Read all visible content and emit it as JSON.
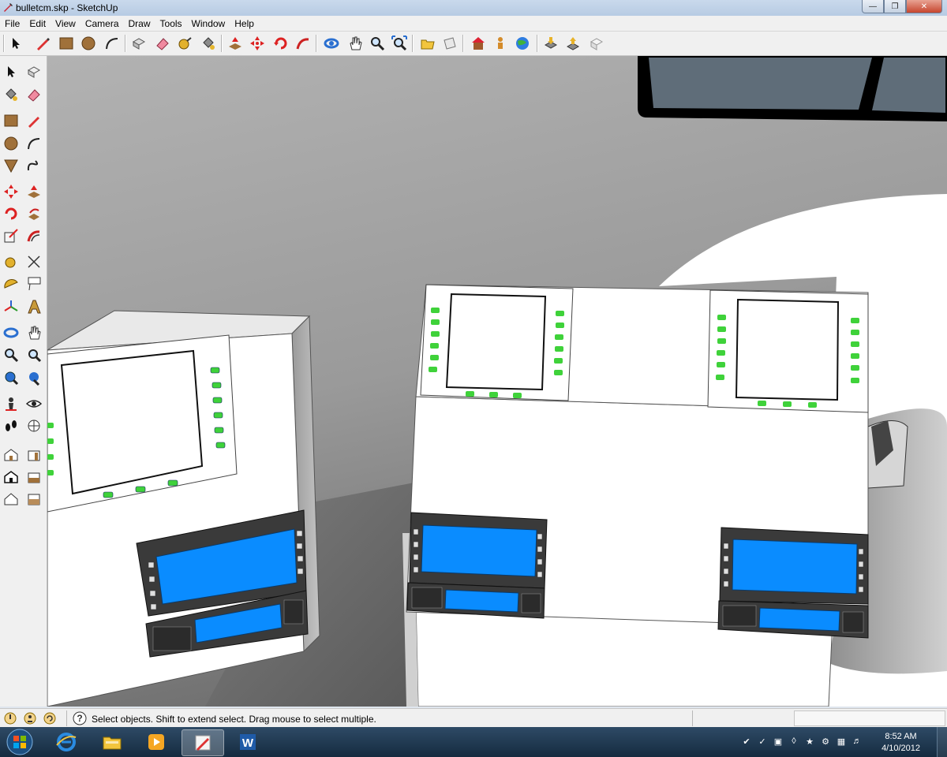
{
  "window": {
    "title": "bulletcm.skp - SketchUp"
  },
  "menu": [
    "File",
    "Edit",
    "View",
    "Camera",
    "Draw",
    "Tools",
    "Window",
    "Help"
  ],
  "status": {
    "message": "Select objects. Shift to extend select. Drag mouse to select multiple."
  },
  "clock": {
    "time": "8:52 AM",
    "date": "4/10/2012"
  },
  "colors": {
    "screen_blue": "#0a8cff",
    "button_green": "#3fd23a",
    "panel_dark": "#3a3a3a"
  }
}
